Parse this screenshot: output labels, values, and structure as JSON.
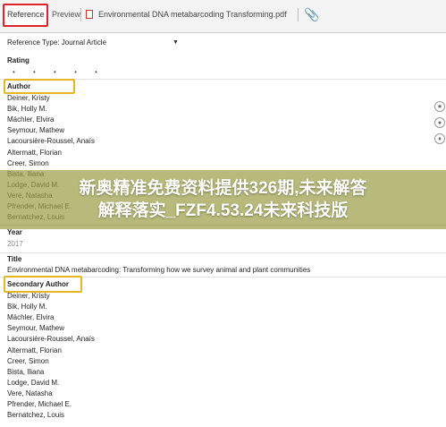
{
  "tabs": {
    "reference": "Reference",
    "preview": "Preview",
    "attachment": "Environmental DNA metabarcoding  Transforming.pdf"
  },
  "reference_type": "Reference Type:  Journal Article",
  "rating": {
    "label": "Rating",
    "dots": "• • • • •"
  },
  "author": {
    "label": "Author",
    "names": [
      "Deiner, Kristy",
      "Bik, Holly M.",
      "Mächler, Elvira",
      "Seymour, Mathew",
      "Lacoursière-Roussel, Anaïs",
      "Altermatt, Florian",
      "Creer, Simon",
      "Bista, Iliana",
      "Lodge, David M.",
      "Vere, Natasha",
      "Pfrender, Michael E.",
      "Bernatchez, Louis"
    ]
  },
  "year": {
    "label": "Year",
    "value": "2017"
  },
  "title": {
    "label": "Title",
    "value": "Environmental DNA metabarcoding: Transforming how we survey animal and plant communities"
  },
  "secondary_author": {
    "label": "Secondary Author",
    "names": [
      "Deiner, Kristy",
      "Bik, Holly M.",
      "Mächler, Elvira",
      "Seymour, Mathew",
      "Lacoursière-Roussel, Anaïs",
      "Altermatt, Florian",
      "Creer, Simon",
      "Bista, Iliana",
      "Lodge, David M.",
      "Vere, Natasha",
      "Pfrender, Michael E.",
      "Bernatchez, Louis"
    ]
  },
  "overlay": {
    "line1": "新奥精准免费资料提供326期,未来解答",
    "line2": "解释落实_FZF4.53.24未来科技版"
  },
  "side_icons": [
    "author-lookup-icon",
    "author-network-icon",
    "author-group-icon"
  ],
  "colors": {
    "reference_highlight": "#d8262b",
    "field_highlight": "#e6b623",
    "overlay": "#9ba046"
  }
}
